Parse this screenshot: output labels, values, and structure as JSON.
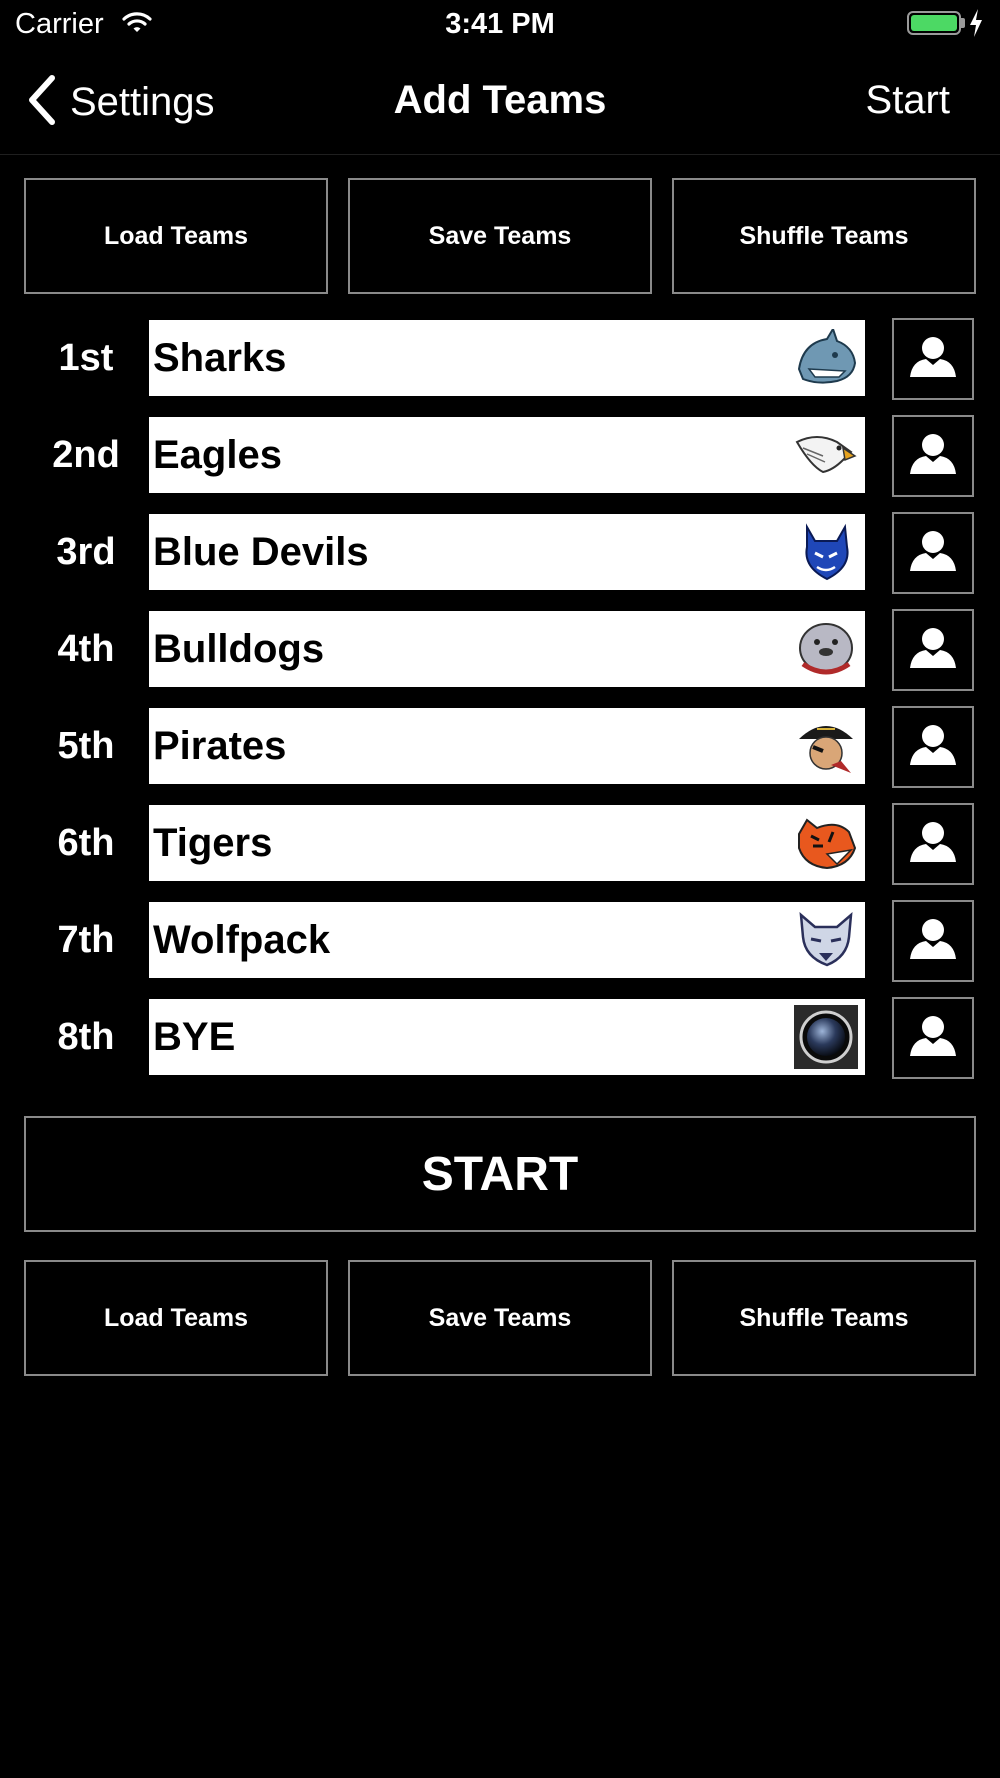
{
  "status_bar": {
    "carrier": "Carrier",
    "time": "3:41 PM",
    "battery_color": "#4cd964"
  },
  "nav": {
    "back_label": "Settings",
    "title": "Add Teams",
    "right_label": "Start"
  },
  "top_buttons": {
    "load": "Load Teams",
    "save": "Save Teams",
    "shuffle": "Shuffle Teams"
  },
  "teams": [
    {
      "rank": "1st",
      "name": "Sharks",
      "logo": "shark-logo-icon"
    },
    {
      "rank": "2nd",
      "name": "Eagles",
      "logo": "eagle-logo-icon"
    },
    {
      "rank": "3rd",
      "name": "Blue Devils",
      "logo": "blue-devil-logo-icon"
    },
    {
      "rank": "4th",
      "name": "Bulldogs",
      "logo": "bulldog-logo-icon"
    },
    {
      "rank": "5th",
      "name": "Pirates",
      "logo": "pirate-logo-icon"
    },
    {
      "rank": "6th",
      "name": "Tigers",
      "logo": "tiger-logo-icon"
    },
    {
      "rank": "7th",
      "name": "Wolfpack",
      "logo": "wolf-logo-icon"
    },
    {
      "rank": "8th",
      "name": "BYE",
      "logo": "bye-logo-icon"
    }
  ],
  "start_button": "START",
  "bottom_buttons": {
    "load": "Load Teams",
    "save": "Save Teams",
    "shuffle": "Shuffle Teams"
  }
}
